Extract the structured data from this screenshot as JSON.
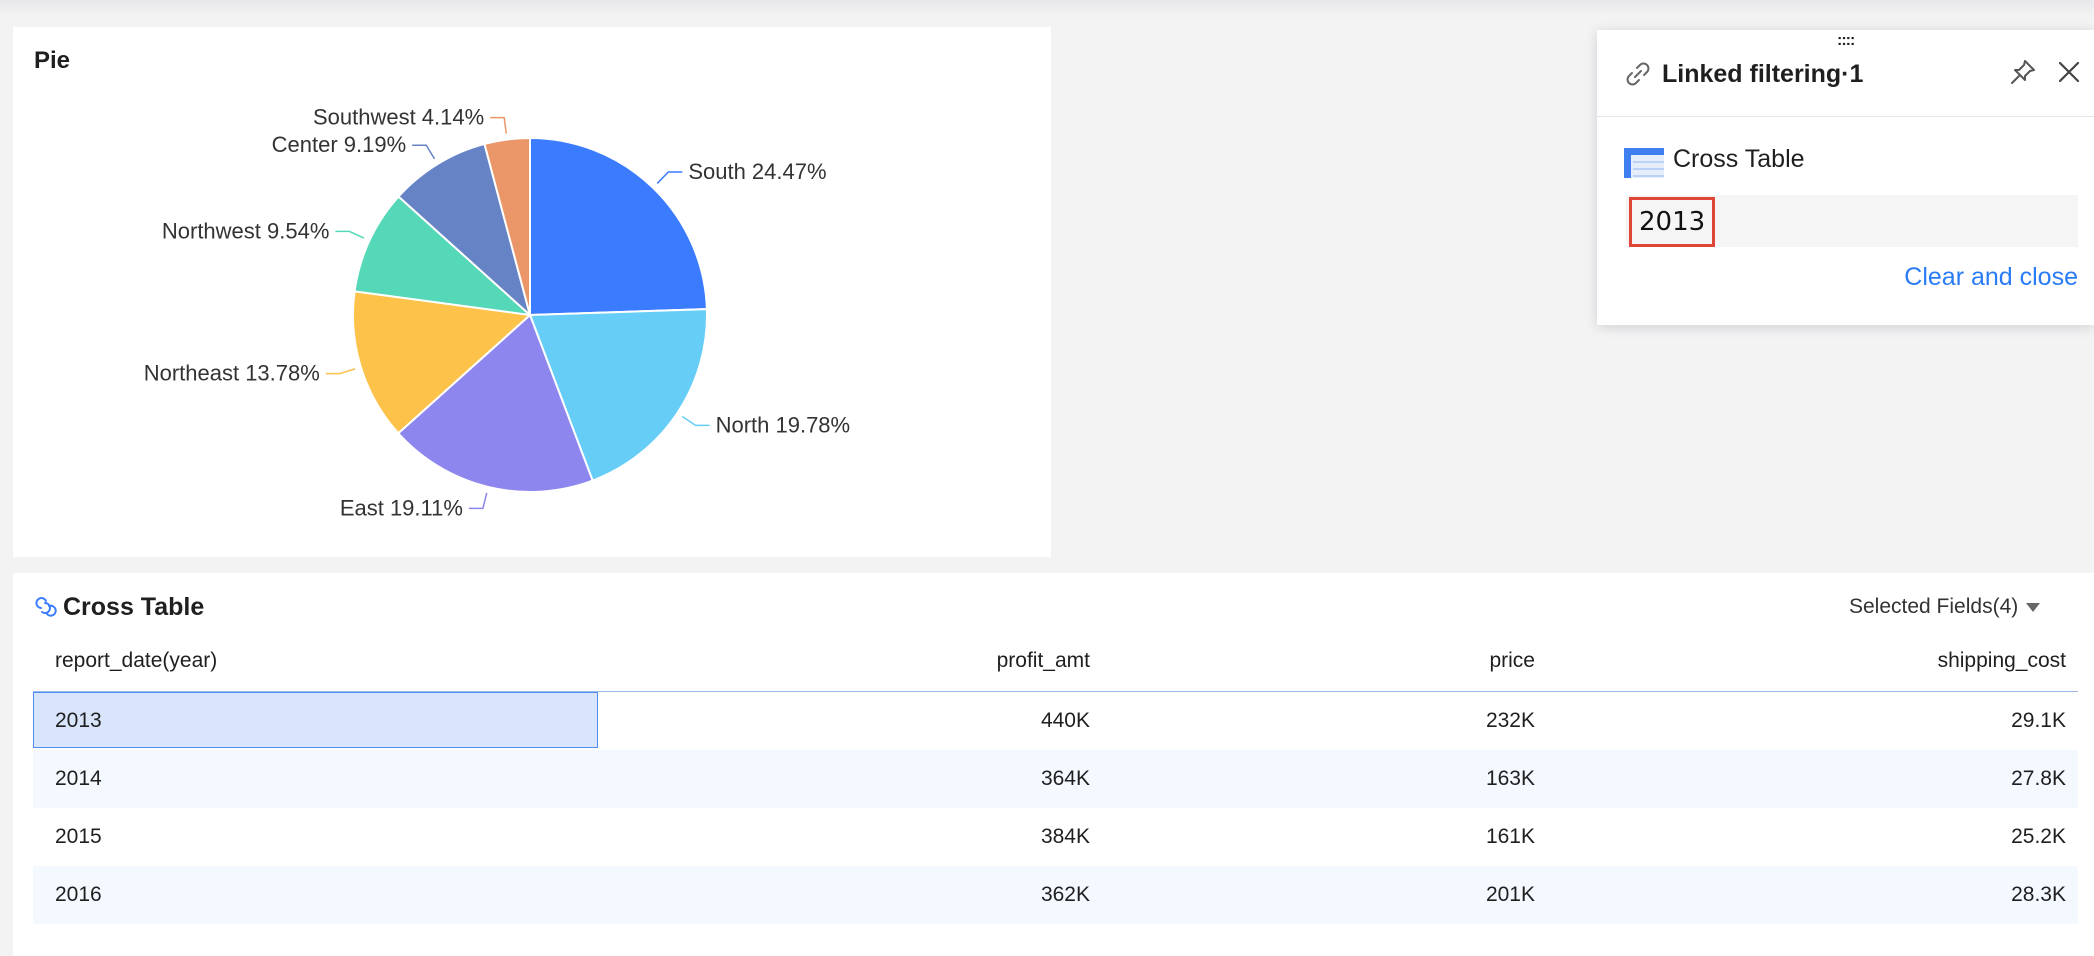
{
  "pie_card": {
    "title": "Pie"
  },
  "chart_data": {
    "type": "pie",
    "title": "Pie",
    "slices": [
      {
        "label": "South",
        "value": 24.47,
        "text": "South 24.47%",
        "color": "#3b7cff"
      },
      {
        "label": "North",
        "value": 19.78,
        "text": "North 19.78%",
        "color": "#66cdf7"
      },
      {
        "label": "East",
        "value": 19.11,
        "text": "East 19.11%",
        "color": "#8c86ee"
      },
      {
        "label": "Northeast",
        "value": 13.78,
        "text": "Northeast 13.78%",
        "color": "#fcc24a"
      },
      {
        "label": "Northwest",
        "value": 9.54,
        "text": "Northwest 9.54%",
        "color": "#55d8b7"
      },
      {
        "label": "Center",
        "value": 9.19,
        "text": "Center 9.19%",
        "color": "#6683c6"
      },
      {
        "label": "Southwest",
        "value": 4.14,
        "text": "Southwest 4.14%",
        "color": "#eb9668"
      }
    ]
  },
  "filter_panel": {
    "drag_handle": "::::",
    "title": "Linked filtering·1",
    "source_name": "Cross Table",
    "selected_value": "2013",
    "clear_label": "Clear and close",
    "accent_color": "#2a7cf6",
    "icons": {
      "link": "link-icon",
      "pin": "pin-icon",
      "close": "close-icon",
      "table": "table-icon"
    }
  },
  "cross_table": {
    "title": "Cross Table",
    "fields_label": "Selected Fields(4)",
    "columns": [
      "report_date(year)",
      "profit_amt",
      "price",
      "shipping_cost"
    ],
    "rows": [
      [
        "2013",
        "440K",
        "232K",
        "29.1K"
      ],
      [
        "2014",
        "364K",
        "163K",
        "27.8K"
      ],
      [
        "2015",
        "384K",
        "161K",
        "25.2K"
      ],
      [
        "2016",
        "362K",
        "201K",
        "28.3K"
      ]
    ],
    "selected_row": 0
  }
}
